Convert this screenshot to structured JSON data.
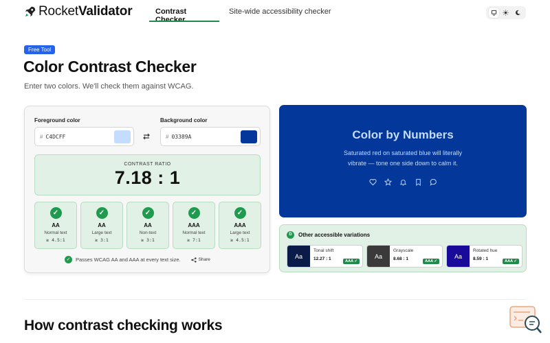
{
  "header": {
    "logo_light": "Rocket",
    "logo_bold": "Validator",
    "tabs": [
      {
        "label": "Contrast Checker",
        "active": true
      },
      {
        "label": "Site-wide accessibility checker",
        "active": false
      }
    ],
    "theme_options": [
      "monitor-icon",
      "sun-icon",
      "moon-icon"
    ]
  },
  "hero": {
    "badge": "Free Tool",
    "title": "Color Contrast Checker",
    "subtitle": "Enter two colors. We'll check them against WCAG."
  },
  "checker": {
    "foreground": {
      "label": "Foreground color",
      "hash": "#",
      "value": "C4DCFF",
      "color": "#C4DCFF"
    },
    "background": {
      "label": "Background color",
      "hash": "#",
      "value": "03389A",
      "color": "#03389A"
    },
    "ratio_label": "CONTRAST RATIO",
    "ratio_value": "7.18 : 1",
    "checks": [
      {
        "level": "AA",
        "type": "Normal text",
        "min": "≥ 4.5:1"
      },
      {
        "level": "AA",
        "type": "Large text",
        "min": "≥ 3:1"
      },
      {
        "level": "AA",
        "type": "Non-text",
        "min": "≥ 3:1"
      },
      {
        "level": "AAA",
        "type": "Normal text",
        "min": "≥ 7:1"
      },
      {
        "level": "AAA",
        "type": "Large text",
        "min": "≥ 4.5:1"
      }
    ],
    "pass_text": "Passes WCAG AA and AAA at every text size.",
    "share_label": "Share"
  },
  "preview": {
    "title": "Color by Numbers",
    "body": "Saturated red on saturated blue will literally vibrate — tone one side down to calm it.",
    "icons": [
      "heart-icon",
      "star-icon",
      "bell-icon",
      "bookmark-icon",
      "chat-icon"
    ]
  },
  "variations": {
    "badge_icon": "D",
    "title": "Other accessible variations",
    "items": [
      {
        "name": "Tonal shift",
        "ratio": "12.27 : 1",
        "badge": "AAA ✓",
        "swatch_text": "Aa",
        "bg": "#0a1b4a",
        "fg": "#ffffff"
      },
      {
        "name": "Grayscale",
        "ratio": "8.68 : 1",
        "badge": "AAA ✓",
        "swatch_text": "Aa",
        "bg": "#3a3a3a",
        "fg": "#ffffff"
      },
      {
        "name": "Rotated hue",
        "ratio": "8.59 : 1",
        "badge": "AAA ✓",
        "swatch_text": "Aa",
        "bg": "#1a0a9a",
        "fg": "#ffffff"
      }
    ]
  },
  "section": {
    "title": "How contrast checking works"
  },
  "colors": {
    "accent_green": "#1f8a4c",
    "badge_blue": "#2563eb",
    "preview_bg": "#03389A",
    "preview_fg": "#C4DCFF"
  }
}
